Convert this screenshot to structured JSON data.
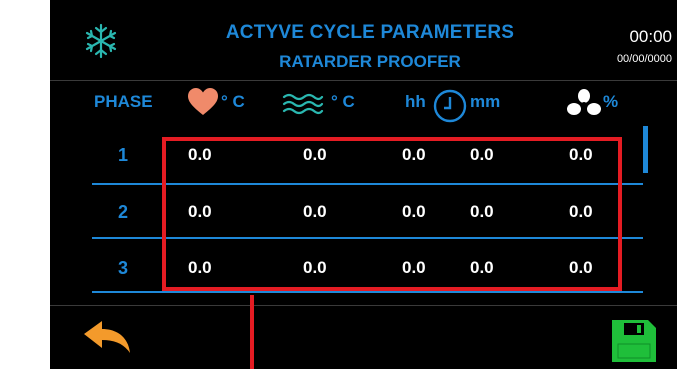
{
  "header": {
    "title": "ACTYVE CYCLE PARAMETERS",
    "subtitle": "RATARDER PROOFER",
    "time": "00:00",
    "date": "00/00/0000",
    "mode_icon": "snowflake-icon"
  },
  "columns": {
    "phase": "PHASE",
    "core_temp_unit": "° C",
    "air_temp_unit": "° C",
    "time_left": "hh",
    "time_right": "mm",
    "fan_unit": "%"
  },
  "rows": [
    {
      "phase": "1",
      "core_temp": "0.0",
      "air_temp": "0.0",
      "hh": "0.0",
      "mm": "0.0",
      "fan": "0.0"
    },
    {
      "phase": "2",
      "core_temp": "0.0",
      "air_temp": "0.0",
      "hh": "0.0",
      "mm": "0.0",
      "fan": "0.0"
    },
    {
      "phase": "3",
      "core_temp": "0.0",
      "air_temp": "0.0",
      "hh": "0.0",
      "mm": "0.0",
      "fan": "0.0"
    }
  ],
  "footer": {
    "back_icon": "back-arrow-icon",
    "save_icon": "save-icon"
  },
  "colors": {
    "accent": "#1e88d8",
    "heart": "#f08a6a",
    "waves": "#2ab7b0",
    "back": "#f39a2b",
    "save": "#1fbf3a",
    "annotation": "#e51c23"
  }
}
